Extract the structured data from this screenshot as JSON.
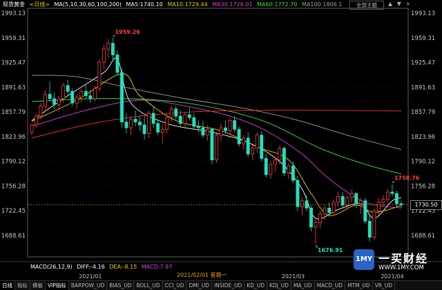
{
  "colors": {
    "up": "#ff4040",
    "down": "#20e0c0",
    "axis": "#c8c8c8",
    "grid": "#4a0000",
    "ma5": "#ffffff",
    "ma10": "#e8d000",
    "ma30": "#e040e0",
    "ma60": "#40e040",
    "ma100": "#a0a0a0",
    "ma200": "#ff3030",
    "current_line": "#e8a000"
  },
  "header": {
    "instrument": "现货黄金",
    "period": "<日线>",
    "ma_params": "MA(5,10,30,60,100,200)",
    "ma5": "MA5:1740.10",
    "ma10": "MA10:1729.44",
    "ma30": "MA30:1726.01",
    "ma60": "MA60:1772.70",
    "ma100": "MA100:1806.1",
    "theme_button": "全部主题",
    "win_controls": [
      "▲",
      "▼",
      "×"
    ]
  },
  "crosshair": {
    "date_label": "2021/02/01 星期一"
  },
  "macd": {
    "label": "MACD(26,12,9)",
    "diff": "DIFF:-4.16",
    "dea": "DEA:-8.15",
    "macd": "MACD:7.97"
  },
  "current_price_tag": "1730.50",
  "tabs": [
    "日线",
    "指标",
    "模板",
    "VIP指标",
    "BARPOW_UD",
    "BIAS_UD",
    "BOLL_UD",
    "CCI_UD",
    "DMI_UD",
    "INSIDE_UD",
    "KD_UD",
    "KDJ_UD",
    "MA_UD",
    "MACD_UD",
    "MTM_UD",
    "VR_UD"
  ],
  "logo": {
    "badge": "1MY",
    "name_cn": "一买财经",
    "url": "WWW.1MY.COM"
  },
  "chart_data": {
    "type": "candlestick",
    "y_ticks": [
      1993.13,
      1959.31,
      1925.47,
      1891.63,
      1857.79,
      1823.96,
      1790.12,
      1756.28,
      1722.45,
      1688.61
    ],
    "ylim": [
      1661,
      1998
    ],
    "x_ticks": [
      "2021/01",
      "2021/03",
      "2021/04"
    ],
    "annotations": [
      {
        "label": "1959.26",
        "value": 1959.26
      },
      {
        "label": "1676.91",
        "value": 1676.91
      },
      {
        "label": "1758.76",
        "value": 1758.76
      }
    ],
    "current_price": 1730.5,
    "candles": [
      [
        1830,
        1842,
        1826,
        1840
      ],
      [
        1840,
        1856,
        1836,
        1852
      ],
      [
        1852,
        1870,
        1848,
        1866
      ],
      [
        1866,
        1888,
        1860,
        1882
      ],
      [
        1882,
        1900,
        1872,
        1876
      ],
      [
        1876,
        1884,
        1862,
        1868
      ],
      [
        1868,
        1880,
        1858,
        1876
      ],
      [
        1876,
        1898,
        1870,
        1894
      ],
      [
        1894,
        1902,
        1880,
        1886
      ],
      [
        1886,
        1890,
        1866,
        1870
      ],
      [
        1870,
        1882,
        1862,
        1878
      ],
      [
        1878,
        1890,
        1870,
        1886
      ],
      [
        1886,
        1895,
        1876,
        1880
      ],
      [
        1880,
        1888,
        1870,
        1876
      ],
      [
        1876,
        1894,
        1872,
        1890
      ],
      [
        1890,
        1930,
        1886,
        1926
      ],
      [
        1926,
        1950,
        1916,
        1944
      ],
      [
        1944,
        1958,
        1932,
        1952
      ],
      [
        1952,
        1959.26,
        1930,
        1936
      ],
      [
        1936,
        1942,
        1908,
        1912
      ],
      [
        1912,
        1918,
        1836,
        1844
      ],
      [
        1844,
        1856,
        1828,
        1836
      ],
      [
        1836,
        1852,
        1826,
        1848
      ],
      [
        1848,
        1860,
        1838,
        1844
      ],
      [
        1844,
        1852,
        1832,
        1840
      ],
      [
        1840,
        1852,
        1820,
        1828
      ],
      [
        1828,
        1860,
        1822,
        1856
      ],
      [
        1856,
        1866,
        1836,
        1842
      ],
      [
        1842,
        1846,
        1826,
        1830
      ],
      [
        1830,
        1842,
        1814,
        1834
      ],
      [
        1834,
        1854,
        1828,
        1850
      ],
      [
        1850,
        1866,
        1844,
        1862
      ],
      [
        1862,
        1866,
        1848,
        1852
      ],
      [
        1852,
        1860,
        1838,
        1842
      ],
      [
        1842,
        1858,
        1836,
        1854
      ],
      [
        1854,
        1864,
        1846,
        1850
      ],
      [
        1850,
        1856,
        1834,
        1838
      ],
      [
        1838,
        1846,
        1830,
        1836
      ],
      [
        1836,
        1846,
        1822,
        1826
      ],
      [
        1826,
        1840,
        1818,
        1834
      ],
      [
        1834,
        1836,
        1786,
        1792
      ],
      [
        1792,
        1830,
        1788,
        1826
      ],
      [
        1826,
        1842,
        1818,
        1836
      ],
      [
        1836,
        1846,
        1828,
        1832
      ],
      [
        1832,
        1850,
        1826,
        1846
      ],
      [
        1846,
        1852,
        1830,
        1834
      ],
      [
        1834,
        1838,
        1810,
        1814
      ],
      [
        1814,
        1826,
        1806,
        1822
      ],
      [
        1822,
        1830,
        1796,
        1800
      ],
      [
        1800,
        1812,
        1792,
        1808
      ],
      [
        1808,
        1830,
        1802,
        1826
      ],
      [
        1826,
        1832,
        1790,
        1794
      ],
      [
        1794,
        1800,
        1768,
        1772
      ],
      [
        1772,
        1790,
        1766,
        1786
      ],
      [
        1786,
        1796,
        1776,
        1792
      ],
      [
        1792,
        1812,
        1786,
        1808
      ],
      [
        1808,
        1810,
        1770,
        1774
      ],
      [
        1774,
        1788,
        1766,
        1784
      ],
      [
        1784,
        1790,
        1760,
        1764
      ],
      [
        1764,
        1770,
        1722,
        1728
      ],
      [
        1728,
        1740,
        1716,
        1736
      ],
      [
        1736,
        1744,
        1722,
        1726
      ],
      [
        1726,
        1730,
        1694,
        1700
      ],
      [
        1700,
        1712,
        1676.91,
        1706
      ],
      [
        1706,
        1722,
        1698,
        1718
      ],
      [
        1718,
        1730,
        1710,
        1726
      ],
      [
        1726,
        1734,
        1714,
        1720
      ],
      [
        1720,
        1738,
        1716,
        1734
      ],
      [
        1734,
        1748,
        1728,
        1742
      ],
      [
        1742,
        1748,
        1726,
        1730
      ],
      [
        1730,
        1744,
        1724,
        1740
      ],
      [
        1740,
        1752,
        1734,
        1746
      ],
      [
        1746,
        1748,
        1726,
        1732
      ],
      [
        1732,
        1740,
        1718,
        1736
      ],
      [
        1736,
        1740,
        1704,
        1708
      ],
      [
        1708,
        1716,
        1680,
        1686
      ],
      [
        1686,
        1726,
        1682,
        1722
      ],
      [
        1722,
        1740,
        1716,
        1734
      ],
      [
        1734,
        1744,
        1728,
        1738
      ],
      [
        1738,
        1752,
        1734,
        1748
      ],
      [
        1748,
        1758.76,
        1742,
        1746
      ],
      [
        1746,
        1750,
        1728,
        1732
      ],
      [
        1732,
        1736,
        1726,
        1730.5
      ]
    ],
    "ma_lines": [
      {
        "name": "MA5",
        "color_key": "ma5",
        "anchors": [
          [
            0,
            1846
          ],
          [
            8,
            1880
          ],
          [
            16,
            1912
          ],
          [
            19,
            1930
          ],
          [
            22,
            1870
          ],
          [
            30,
            1842
          ],
          [
            40,
            1830
          ],
          [
            48,
            1816
          ],
          [
            55,
            1790
          ],
          [
            60,
            1752
          ],
          [
            63,
            1712
          ],
          [
            68,
            1724
          ],
          [
            73,
            1732
          ],
          [
            76,
            1712
          ],
          [
            80,
            1736
          ],
          [
            82,
            1740
          ]
        ]
      },
      {
        "name": "MA10",
        "color_key": "ma10",
        "anchors": [
          [
            0,
            1845
          ],
          [
            10,
            1874
          ],
          [
            20,
            1910
          ],
          [
            24,
            1880
          ],
          [
            32,
            1846
          ],
          [
            42,
            1832
          ],
          [
            50,
            1810
          ],
          [
            57,
            1792
          ],
          [
            62,
            1746
          ],
          [
            66,
            1716
          ],
          [
            72,
            1730
          ],
          [
            76,
            1720
          ],
          [
            82,
            1729.44
          ]
        ]
      },
      {
        "name": "MA30",
        "color_key": "ma30",
        "anchors": [
          [
            0,
            1838
          ],
          [
            12,
            1860
          ],
          [
            24,
            1874
          ],
          [
            34,
            1866
          ],
          [
            44,
            1852
          ],
          [
            52,
            1832
          ],
          [
            60,
            1800
          ],
          [
            66,
            1766
          ],
          [
            74,
            1734
          ],
          [
            82,
            1726
          ]
        ]
      },
      {
        "name": "MA60",
        "color_key": "ma60",
        "anchors": [
          [
            0,
            1872
          ],
          [
            14,
            1876
          ],
          [
            28,
            1874
          ],
          [
            40,
            1864
          ],
          [
            52,
            1844
          ],
          [
            64,
            1808
          ],
          [
            74,
            1786
          ],
          [
            82,
            1772.7
          ]
        ]
      },
      {
        "name": "MA100",
        "color_key": "ma100",
        "anchors": [
          [
            0,
            1908
          ],
          [
            10,
            1906
          ],
          [
            22,
            1890
          ],
          [
            34,
            1876
          ],
          [
            46,
            1864
          ],
          [
            58,
            1848
          ],
          [
            70,
            1826
          ],
          [
            82,
            1806.1
          ]
        ]
      },
      {
        "name": "MA200",
        "color_key": "ma200",
        "anchors": [
          [
            0,
            1822
          ],
          [
            12,
            1840
          ],
          [
            24,
            1852
          ],
          [
            36,
            1858
          ],
          [
            50,
            1860
          ],
          [
            66,
            1860
          ],
          [
            82,
            1859
          ]
        ]
      }
    ]
  }
}
